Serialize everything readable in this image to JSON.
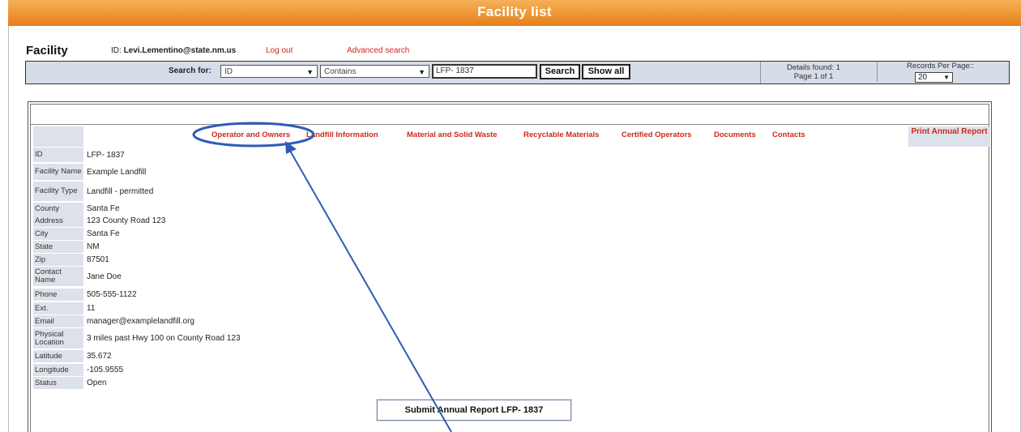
{
  "window": {
    "title": "Facility list"
  },
  "header": {
    "heading": "Facility",
    "user_id_label": "ID:",
    "user_email": "Levi.Lementino@state.nm.us",
    "logout": "Log out",
    "advanced_search": "Advanced search"
  },
  "search": {
    "label": "Search for:",
    "field_value": "ID",
    "operator_value": "Contains",
    "query": "LFP- 1837",
    "search_button": "Search",
    "show_all_button": "Show all",
    "details_found": "Details found: 1",
    "page_info": "Page 1 of 1",
    "records_per_page_label": "Records Per Page::",
    "records_per_page": "20"
  },
  "tabs": [
    {
      "label": "Operator and Owners"
    },
    {
      "label": "Landfill Information"
    },
    {
      "label": "Material and Solid Waste"
    },
    {
      "label": "Recyclable Materials"
    },
    {
      "label": "Certified Operators"
    },
    {
      "label": "Documents"
    },
    {
      "label": "Contacts"
    }
  ],
  "print_report": "Print Annual Report",
  "details": [
    {
      "label": "ID",
      "value": "LFP- 1837"
    },
    {
      "label": "Facility Name",
      "value": "Example Landfill"
    },
    {
      "label": "Facility Type",
      "value": "Landfill - permitted"
    },
    {
      "label": "County",
      "value": "Santa Fe"
    },
    {
      "label": "Address",
      "value": "123 County Road 123"
    },
    {
      "label": "City",
      "value": "Santa Fe"
    },
    {
      "label": "State",
      "value": "NM"
    },
    {
      "label": "Zip",
      "value": "87501"
    },
    {
      "label": "Contact Name",
      "value": "Jane Doe"
    },
    {
      "label": "Phone",
      "value": "505-555-1122"
    },
    {
      "label": "Ext.",
      "value": "11"
    },
    {
      "label": "Email",
      "value": "manager@examplelandfill.org"
    },
    {
      "label": "Physical Location",
      "value": "3 miles past Hwy 100 on County Road 123"
    },
    {
      "label": "Latitude",
      "value": "35.672"
    },
    {
      "label": "Longitude",
      "value": "-105.9555"
    },
    {
      "label": "Status",
      "value": "Open"
    }
  ],
  "submit_button": "Submit Annual Report LFP- 1837",
  "colors": {
    "title_bar": "#ef9a3a",
    "link_red": "#cc2a1a",
    "label_bg": "#dde2ea",
    "search_bar_bg": "#d6dde8",
    "annotation": "#2e5cb8"
  },
  "icons": {
    "dropdown": "chevron-down-icon",
    "annotation_arrow": "arrow-icon"
  }
}
